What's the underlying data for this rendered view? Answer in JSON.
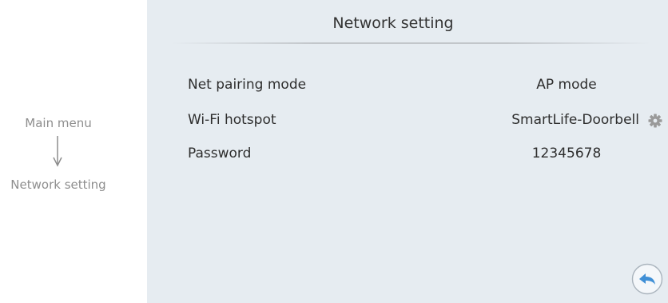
{
  "nav_path": {
    "from": "Main menu",
    "to": "Network setting"
  },
  "screen": {
    "title": "Network setting",
    "rows": [
      {
        "label": "Net pairing mode",
        "value": "AP mode"
      },
      {
        "label": "Wi-Fi hotspot",
        "value": "SmartLife-Doorbell"
      },
      {
        "label": "Password",
        "value": "12345678"
      }
    ]
  },
  "icons": {
    "arrow": "arrow-down-icon",
    "settings": "gear-icon",
    "back": "back-arrow-icon"
  },
  "colors": {
    "screen_background": "#e6ecf1",
    "back_icon_color": "#3f8fd6",
    "gear_color": "#9a9a9a",
    "nav_text_color": "#8e8e8e"
  }
}
